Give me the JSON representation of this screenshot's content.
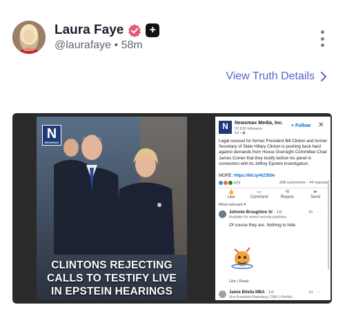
{
  "post": {
    "author_name": "Laura Faye",
    "handle": "@laurafaye",
    "separator": "•",
    "time_ago": "58m",
    "view_details_label": "View Truth Details",
    "accent_color": "#5b5fcf"
  },
  "media": {
    "logo_letter": "N",
    "logo_caption": "NEWSMAX",
    "headline_line1": "CLINTONS REJECTING",
    "headline_line2": "CALLS TO TESTIFY LIVE",
    "headline_line3": "IN EPSTEIN HEARINGS"
  },
  "linkedin": {
    "publisher_name": "Newsmax Media, Inc.",
    "followers": "97,833 followers",
    "posted": "1d • ",
    "follow_label": "+ Follow",
    "close_label": "✕",
    "post_text": "Legal counsel for former President Bill Clinton and former Secretary of State Hillary Clinton is pushing back hard against demands from House Oversight Committee Chair James Comer that they testify before his panel in connection with its Jeffrey Epstein investigation.",
    "more_label": "MORE: ",
    "more_link": "https://bit.ly/4iZ350v",
    "reaction_count": "429",
    "comments_reposts": "268 comments · 44 reposts",
    "actions": [
      "Like",
      "Comment",
      "Repost",
      "Send"
    ],
    "sort_label": "Most relevant ▾",
    "comment1": {
      "name": "Johnnie Broughton Sr",
      "badge": "· 1st",
      "subtitle": "Available for armed security positions.",
      "time": "2h",
      "dots": "···",
      "text": "Of course they are. Nothing to hide.",
      "footer": "Like | Reply"
    },
    "comment2": {
      "name": "Jamie Bilella MBA",
      "badge": "· 1st",
      "subtitle": "Vice President Marketing | CMO | Portfoli...",
      "time": "1d",
      "dots": "···"
    }
  }
}
